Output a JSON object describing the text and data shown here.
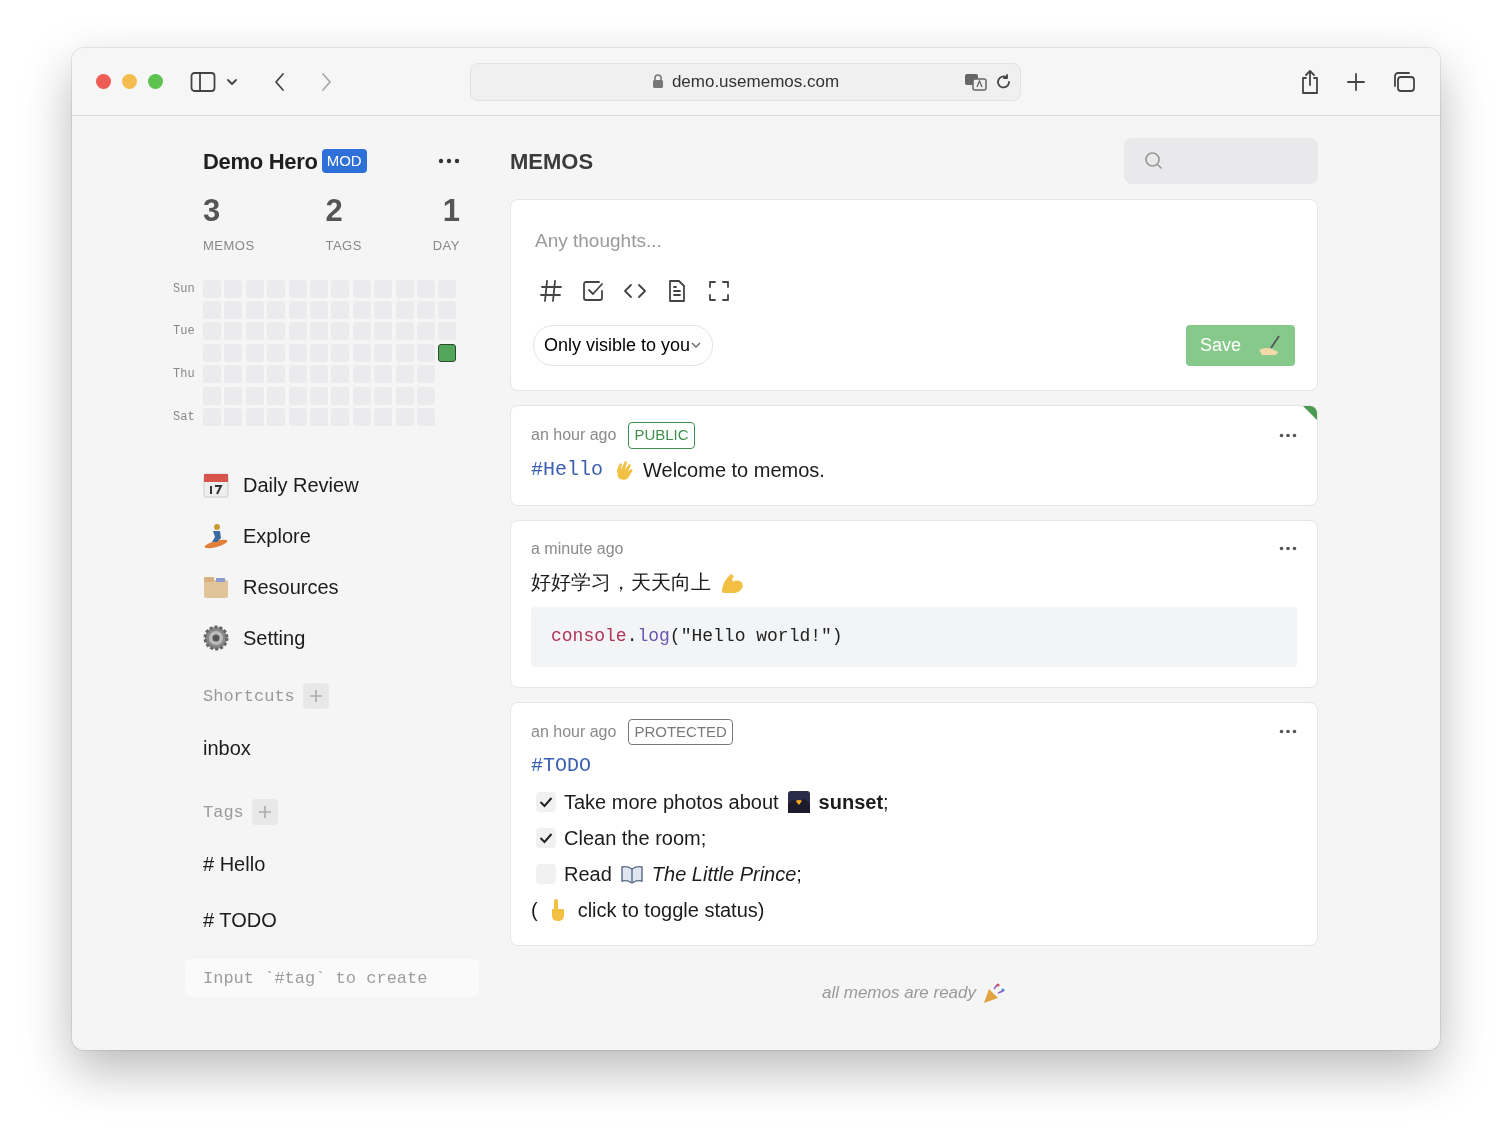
{
  "browser": {
    "url": "demo.usememos.com"
  },
  "user": {
    "name": "Demo Hero",
    "role": "MOD"
  },
  "stats": [
    {
      "value": "3",
      "label": "MEMOS"
    },
    {
      "value": "2",
      "label": "TAGS"
    },
    {
      "value": "1",
      "label": "DAY"
    }
  ],
  "heatmap": {
    "day_labels": [
      "Sun",
      "Tue",
      "Thu",
      "Sat"
    ],
    "weeks": [
      [
        false,
        false,
        false,
        false,
        false,
        false,
        false
      ],
      [
        false,
        false,
        false,
        false,
        false,
        false,
        false
      ],
      [
        false,
        false,
        false,
        false,
        false,
        false,
        false
      ],
      [
        false,
        false,
        false,
        false,
        false,
        false,
        false
      ],
      [
        false,
        false,
        false,
        false,
        false,
        false,
        false
      ],
      [
        false,
        false,
        false,
        false,
        false,
        false,
        false
      ],
      [
        false,
        false,
        false,
        false,
        false,
        false,
        false
      ],
      [
        false,
        false,
        false,
        false,
        false,
        false,
        false
      ],
      [
        false,
        false,
        false,
        false,
        false,
        false,
        false
      ],
      [
        false,
        false,
        false,
        false,
        false,
        false,
        false
      ],
      [
        false,
        false,
        false,
        false,
        false,
        false,
        false
      ],
      [
        false,
        false,
        false,
        true
      ]
    ]
  },
  "nav": [
    {
      "label": "Daily Review"
    },
    {
      "label": "Explore"
    },
    {
      "label": "Resources"
    },
    {
      "label": "Setting"
    }
  ],
  "shortcuts": {
    "title": "Shortcuts",
    "items": [
      {
        "label": "inbox"
      }
    ]
  },
  "tags": {
    "title": "Tags",
    "items": [
      {
        "label": "# Hello"
      },
      {
        "label": "# TODO"
      }
    ]
  },
  "tag_input": {
    "placeholder": "Input `#tag` to create"
  },
  "main": {
    "title": "MEMOS"
  },
  "editor": {
    "placeholder": "Any thoughts...",
    "visibility": "Only visible to you",
    "save": "Save"
  },
  "memos": [
    {
      "time": "an hour ago",
      "pinned": true,
      "visibility": {
        "label": "PUBLIC",
        "color": "#3f8f4e"
      },
      "blocks": [
        {
          "kind": "line",
          "parts": [
            {
              "kind": "tag",
              "text": "#Hello"
            },
            {
              "kind": "emoji"
            },
            {
              "kind": "text",
              "text": "Welcome to memos."
            }
          ]
        }
      ]
    },
    {
      "time": "a minute ago",
      "pinned": false,
      "blocks": [
        {
          "kind": "line",
          "parts": [
            {
              "kind": "text",
              "text": "好好学习，天天向上"
            },
            {
              "kind": "emoji"
            }
          ]
        },
        {
          "kind": "code",
          "tokens": [
            {
              "kind": "object",
              "text": "console"
            },
            {
              "kind": "plain",
              "text": "."
            },
            {
              "kind": "method",
              "text": "log"
            },
            {
              "kind": "plain",
              "text": "(\"Hello world!\")"
            }
          ]
        }
      ]
    },
    {
      "time": "an hour ago",
      "pinned": false,
      "visibility": {
        "label": "PROTECTED",
        "color": "#7a7a7a"
      },
      "blocks": [
        {
          "kind": "line",
          "parts": [
            {
              "kind": "tag",
              "text": "#TODO"
            }
          ]
        },
        {
          "kind": "task",
          "checked": true,
          "parts": [
            {
              "kind": "text",
              "text": "Take more photos about"
            },
            {
              "kind": "emoji"
            },
            {
              "kind": "text",
              "text": "**sunset**;"
            }
          ]
        },
        {
          "kind": "task",
          "checked": true,
          "parts": [
            {
              "kind": "text",
              "text": "Clean the room;"
            }
          ]
        },
        {
          "kind": "task",
          "checked": false,
          "parts": [
            {
              "kind": "text",
              "text": "Read"
            },
            {
              "kind": "emoji"
            },
            {
              "kind": "text",
              "text": "*The Little Prince*;"
            }
          ]
        },
        {
          "kind": "line",
          "parts": [
            {
              "kind": "text",
              "text": "("
            },
            {
              "kind": "emoji"
            },
            {
              "kind": "text",
              "text": "click to toggle status)"
            }
          ]
        }
      ]
    }
  ],
  "footer": {
    "text": "all memos are ready"
  }
}
